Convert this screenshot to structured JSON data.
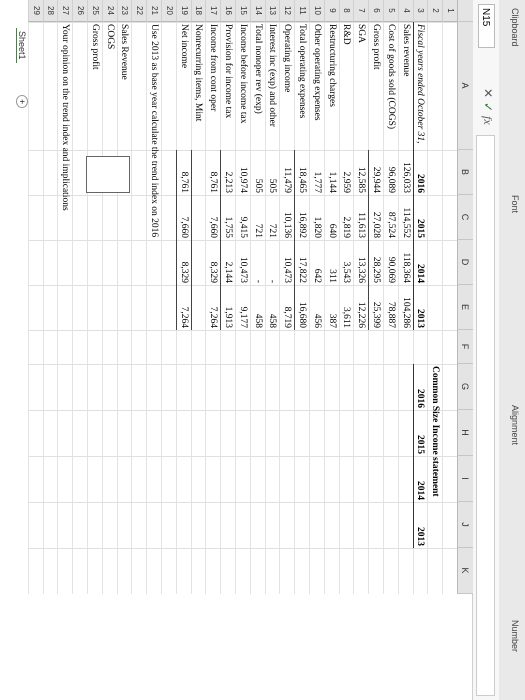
{
  "ribbon": {
    "clipboard": "Clipboard",
    "font": "Font",
    "alignment": "Alignment",
    "number": "Number"
  },
  "formula_bar": {
    "name_box": "N15",
    "cancel": "✕",
    "enter": "✓",
    "fx": "fx"
  },
  "columns": [
    "A",
    "B",
    "C",
    "D",
    "E",
    "F",
    "G",
    "H",
    "I",
    "J",
    "K"
  ],
  "rows": [
    "1",
    "2",
    "3",
    "4",
    "5",
    "6",
    "7",
    "8",
    "9",
    "10",
    "11",
    "12",
    "13",
    "14",
    "15",
    "16",
    "17",
    "18",
    "19",
    "20",
    "21",
    "22",
    "23",
    "24",
    "25",
    "26",
    "27",
    "28",
    "29"
  ],
  "table": {
    "title": "Fiscal years ended October 31,",
    "years": [
      "2016",
      "2015",
      "2014",
      "2013"
    ],
    "lines": [
      {
        "label": "Sales revenue",
        "v": [
          "126,033",
          "114,552",
          "118,364",
          "104,286"
        ]
      },
      {
        "label": "Cost of goods sold (COGS)",
        "v": [
          "96,089",
          "87,524",
          "90,069",
          "78,887"
        ]
      },
      {
        "label": "Gross profit",
        "v": [
          "29,944",
          "27,028",
          "28,295",
          "25,399"
        ]
      },
      {
        "label": "SGA",
        "v": [
          "12,585",
          "11,613",
          "13,326",
          "12,226"
        ]
      },
      {
        "label": "R&D",
        "v": [
          "2,959",
          "2,819",
          "3,543",
          "3,611"
        ]
      },
      {
        "label": "Restructuring charges",
        "v": [
          "1,144",
          "640",
          "311",
          "387"
        ]
      },
      {
        "label": "Other operating expenses",
        "v": [
          "1,777",
          "1,820",
          "642",
          "456"
        ]
      },
      {
        "label": "Total operating expenses",
        "v": [
          "18,465",
          "16,892",
          "17,822",
          "16,680"
        ]
      },
      {
        "label": "Operating income",
        "v": [
          "11,479",
          "10,136",
          "10,473",
          "8,719"
        ]
      },
      {
        "label": "Interest inc (exp) and other",
        "v": [
          "505",
          "721",
          "-",
          "458"
        ]
      },
      {
        "label": "Total nonoper rev (exp)",
        "v": [
          "505",
          "721",
          "-",
          "458"
        ]
      },
      {
        "label": "Income before income tax",
        "v": [
          "10,974",
          "9,415",
          "10,473",
          "9,177"
        ]
      },
      {
        "label": "Provision for income tax",
        "v": [
          "2,213",
          "1,755",
          "2,144",
          "1,913"
        ]
      },
      {
        "label": "Income from cont oper",
        "v": [
          "8,761",
          "7,660",
          "8,329",
          "7,264"
        ]
      },
      {
        "label": "Nonrecurring items, Mint",
        "v": [
          "",
          "",
          "",
          ""
        ]
      },
      {
        "label": "Net income",
        "v": [
          "8,761",
          "7,660",
          "8,329",
          "7,264"
        ]
      }
    ]
  },
  "common_size": {
    "title": "Common Size Income statement",
    "years": [
      "2016",
      "2015",
      "2014",
      "2013"
    ]
  },
  "notes": {
    "trend_instruction": "Use 2013 as base year calculate the trend index on 2016",
    "items": [
      "Sales Revenue",
      "COGS",
      "Gross profit"
    ],
    "opinion": "Your opinion on the trend index and implications"
  },
  "sheet_tab": "Sheet1",
  "add_sheet": "+"
}
